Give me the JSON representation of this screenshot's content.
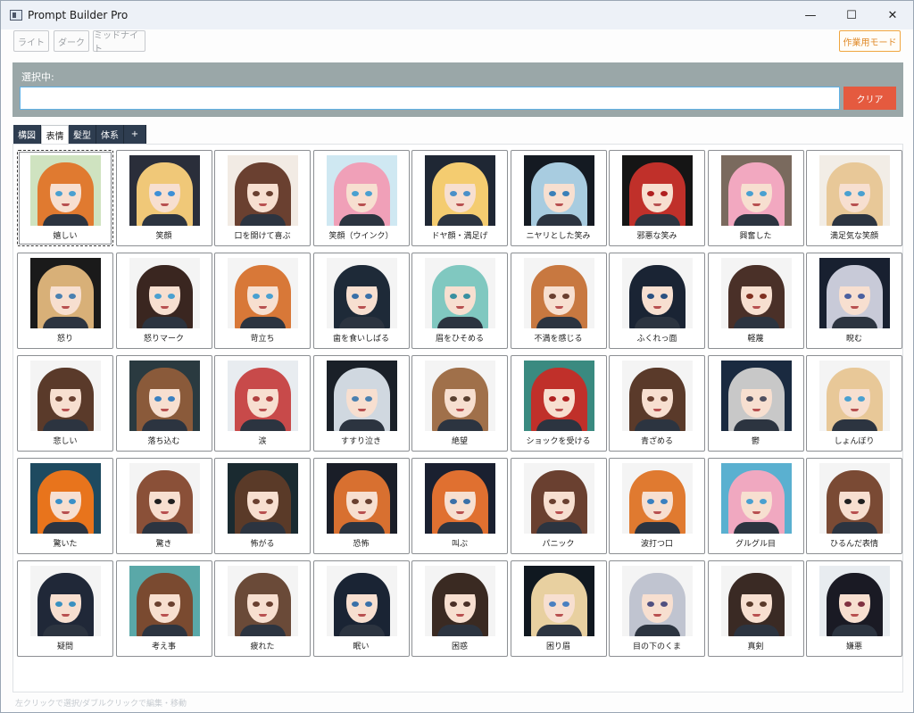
{
  "window": {
    "title": "Prompt Builder Pro",
    "controls": [
      "—",
      "☐",
      "✕"
    ]
  },
  "themes": [
    "ライト",
    "ダーク",
    "ミッドナイト"
  ],
  "work_mode_label": "作業用モード",
  "selection": {
    "label": "選択中:",
    "value": "",
    "clear_label": "クリア"
  },
  "tabs": [
    {
      "label": "構図",
      "active": false
    },
    {
      "label": "表情",
      "active": true
    },
    {
      "label": "髪型",
      "active": false
    },
    {
      "label": "体系",
      "active": false
    },
    {
      "label": "+",
      "active": false
    }
  ],
  "grid": {
    "columns": 9,
    "items": [
      {
        "label": "嬉しい",
        "hair": "#e07a30",
        "eyes": "#4aa0d0",
        "bg": "#cfe3c0",
        "selected": true
      },
      {
        "label": "笑顔",
        "hair": "#f0c878",
        "eyes": "#3d8fd6",
        "bg": "#2a2e3a"
      },
      {
        "label": "口を開けて喜ぶ",
        "hair": "#6a4030",
        "eyes": "#6a4030",
        "bg": "#f2ebe4"
      },
      {
        "label": "笑顔（ウインク）",
        "hair": "#f0a0b8",
        "eyes": "#4aa0d0",
        "bg": "#cfe8f2"
      },
      {
        "label": "ドヤ顔・満足げ",
        "hair": "#f4cc70",
        "eyes": "#4a90c8",
        "bg": "#1f2734"
      },
      {
        "label": "ニヤリとした笑み",
        "hair": "#a8cce0",
        "eyes": "#3a80b8",
        "bg": "#141a22"
      },
      {
        "label": "邪悪な笑み",
        "hair": "#c0302a",
        "eyes": "#b02020",
        "bg": "#151515"
      },
      {
        "label": "興奮した",
        "hair": "#f2a8c0",
        "eyes": "#4aa0d0",
        "bg": "#7a6a5e"
      },
      {
        "label": "満足気な笑顔",
        "hair": "#e8c898",
        "eyes": "#4aa0d0",
        "bg": "#f2ede6"
      },
      {
        "label": "怒り",
        "hair": "#d8b078",
        "eyes": "#4a80b0",
        "bg": "#1a1a1a"
      },
      {
        "label": "怒りマーク",
        "hair": "#3a2620",
        "eyes": "#4aa0d0",
        "bg": "#f4f4f4"
      },
      {
        "label": "苛立ち",
        "hair": "#d87838",
        "eyes": "#4aa0d0",
        "bg": "#f4f4f4"
      },
      {
        "label": "歯を食いしばる",
        "hair": "#1e2a38",
        "eyes": "#3a70a8",
        "bg": "#f4f4f4"
      },
      {
        "label": "眉をひそめる",
        "hair": "#80c8c0",
        "eyes": "#3a90a0",
        "bg": "#f4f4f4"
      },
      {
        "label": "不満を感じる",
        "hair": "#c87840",
        "eyes": "#6a4030",
        "bg": "#f4f4f4"
      },
      {
        "label": "ふくれっ面",
        "hair": "#1a2434",
        "eyes": "#2a5080",
        "bg": "#f4f4f4"
      },
      {
        "label": "軽蔑",
        "hair": "#4a3028",
        "eyes": "#803020",
        "bg": "#f4f4f4"
      },
      {
        "label": "睨む",
        "hair": "#c8cad8",
        "eyes": "#4a60a0",
        "bg": "#182030"
      },
      {
        "label": "悲しい",
        "hair": "#5a3a2a",
        "eyes": "#6a4030",
        "bg": "#f4f4f4"
      },
      {
        "label": "落ち込む",
        "hair": "#8a5a3a",
        "eyes": "#3a80c0",
        "bg": "#2a3a40"
      },
      {
        "label": "涙",
        "hair": "#c84a4a",
        "eyes": "#b04040",
        "bg": "#e8ecf0"
      },
      {
        "label": "すすり泣き",
        "hair": "#d0d8e0",
        "eyes": "#4a80b0",
        "bg": "#1a2028"
      },
      {
        "label": "絶望",
        "hair": "#a0704a",
        "eyes": "#5a4030",
        "bg": "#f4f4f4"
      },
      {
        "label": "ショックを受ける",
        "hair": "#c0302a",
        "eyes": "#b02020",
        "bg": "#3a8a80"
      },
      {
        "label": "青ざめる",
        "hair": "#5a3a2a",
        "eyes": "#6a4030",
        "bg": "#f4f4f4"
      },
      {
        "label": "鬱",
        "hair": "#c8c8c8",
        "eyes": "#505060",
        "bg": "#1a2a40"
      },
      {
        "label": "しょんぼり",
        "hair": "#e8c898",
        "eyes": "#4aa0d0",
        "bg": "#f4f4f4"
      },
      {
        "label": "驚いた",
        "hair": "#e8741c",
        "eyes": "#3a90c8",
        "bg": "#1e4a60"
      },
      {
        "label": "驚き",
        "hair": "#8a5038",
        "eyes": "#202020",
        "bg": "#f4f4f4"
      },
      {
        "label": "怖がる",
        "hair": "#5a3a28",
        "eyes": "#6a4030",
        "bg": "#1a2a30"
      },
      {
        "label": "恐怖",
        "hair": "#d87030",
        "eyes": "#6a4030",
        "bg": "#1a1e28"
      },
      {
        "label": "叫ぶ",
        "hair": "#e07030",
        "eyes": "#3a70a8",
        "bg": "#1a2030"
      },
      {
        "label": "パニック",
        "hair": "#6a4030",
        "eyes": "#6a4030",
        "bg": "#f4f4f4"
      },
      {
        "label": "波打つ口",
        "hair": "#e07a30",
        "eyes": "#3a80c0",
        "bg": "#f4f4f4"
      },
      {
        "label": "グルグル目",
        "hair": "#f0a8c0",
        "eyes": "#4aa0d0",
        "bg": "#5ab0d0"
      },
      {
        "label": "ひるんだ表情",
        "hair": "#7a4a34",
        "eyes": "#202020",
        "bg": "#f4f4f4"
      },
      {
        "label": "疑問",
        "hair": "#202838",
        "eyes": "#3a90c0",
        "bg": "#f4f4f4"
      },
      {
        "label": "考え事",
        "hair": "#7a4a30",
        "eyes": "#6a4030",
        "bg": "#5aa8a8"
      },
      {
        "label": "疲れた",
        "hair": "#6a4a38",
        "eyes": "#6a4030",
        "bg": "#f4f4f4"
      },
      {
        "label": "眠い",
        "hair": "#1a2434",
        "eyes": "#3a70a8",
        "bg": "#f4f4f4"
      },
      {
        "label": "困惑",
        "hair": "#3a2a22",
        "eyes": "#4a3028",
        "bg": "#f4f4f4"
      },
      {
        "label": "困り眉",
        "hair": "#e8d0a0",
        "eyes": "#4a80c0",
        "bg": "#101820"
      },
      {
        "label": "目の下のくま",
        "hair": "#c0c4d0",
        "eyes": "#505080",
        "bg": "#f4f4f4"
      },
      {
        "label": "真剣",
        "hair": "#3a2a24",
        "eyes": "#5a3a2a",
        "bg": "#f4f4f4"
      },
      {
        "label": "嫌悪",
        "hair": "#1a1a24",
        "eyes": "#803040",
        "bg": "#e8ecf0"
      }
    ]
  },
  "status_text": "左クリックで選択/ダブルクリックで編集・移動"
}
